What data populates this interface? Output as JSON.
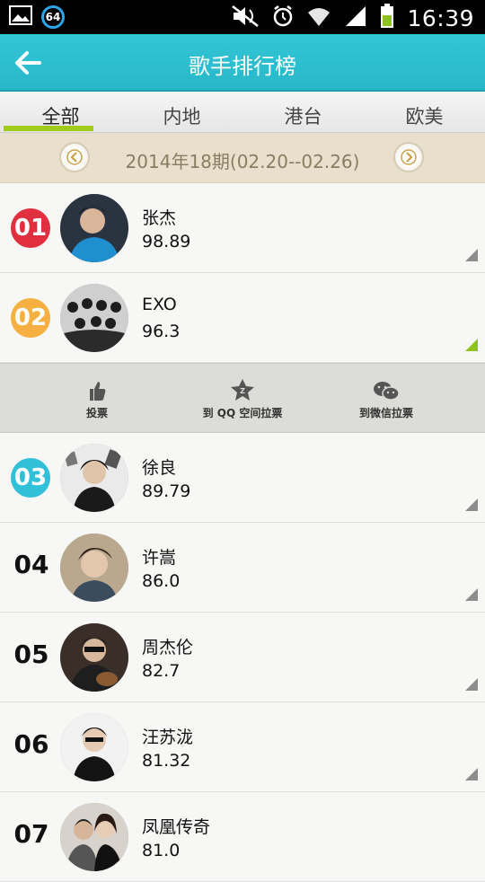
{
  "status_bar": {
    "time": "16:39",
    "notification_badge": "64"
  },
  "app_bar": {
    "title": "歌手排行榜",
    "back_icon": "back-arrow-icon"
  },
  "tabs": [
    {
      "label": "全部",
      "active": true
    },
    {
      "label": "内地"
    },
    {
      "label": "港台"
    },
    {
      "label": "欧美"
    }
  ],
  "period": {
    "label": "2014年18期(02.20--02.26)"
  },
  "actions": [
    {
      "label": "投票",
      "icon": "thumbs-up-icon"
    },
    {
      "label": "到 QQ 空间拉票",
      "icon": "qzone-icon"
    },
    {
      "label": "到微信拉票",
      "icon": "wechat-icon"
    }
  ],
  "ranking": [
    {
      "rank": "01",
      "name": "张杰",
      "score": "98.89",
      "rank_color": "#e03040"
    },
    {
      "rank": "02",
      "name": "EXO",
      "score": "96.3",
      "rank_color": "#f5b041"
    },
    {
      "rank": "03",
      "name": "徐良",
      "score": "89.79",
      "rank_color": "#32c0d8"
    },
    {
      "rank": "04",
      "name": "许嵩",
      "score": "86.0"
    },
    {
      "rank": "05",
      "name": "周杰伦",
      "score": "82.7"
    },
    {
      "rank": "06",
      "name": "汪苏泷",
      "score": "81.32"
    },
    {
      "rank": "07",
      "name": "凤凰传奇",
      "score": "81.0"
    }
  ],
  "colors": {
    "accent": "#2fc0d2",
    "tab_indicator": "#9fcc1a",
    "period_bg": "#e8e0cc"
  }
}
